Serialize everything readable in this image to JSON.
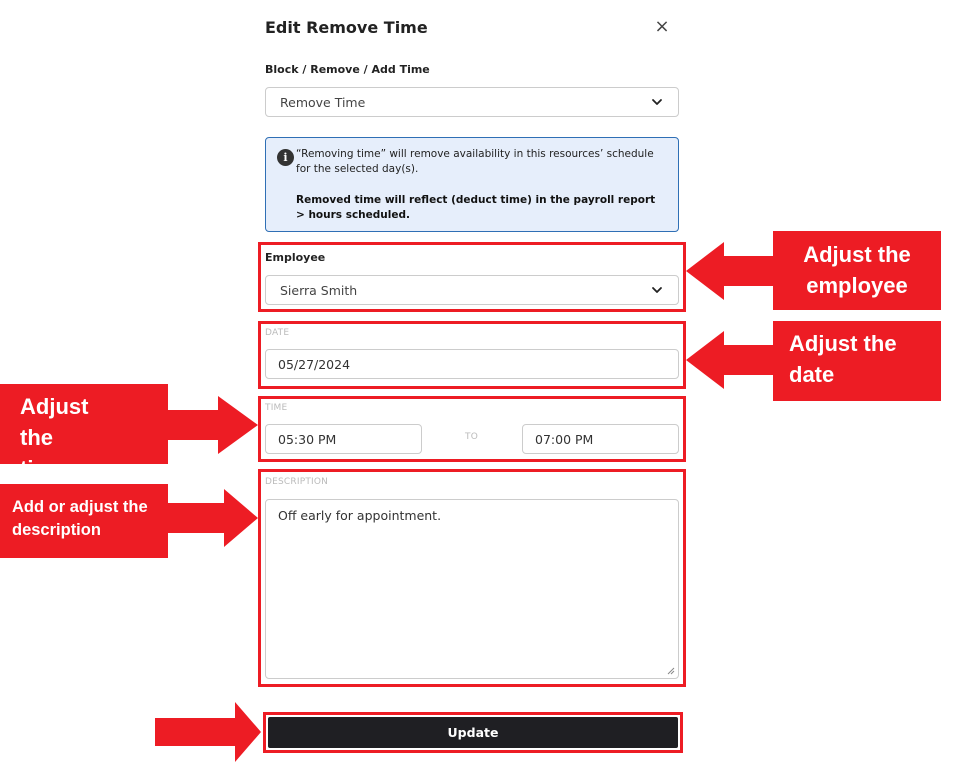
{
  "modal": {
    "title": "Edit Remove Time",
    "close_icon": "×"
  },
  "type_field": {
    "label": "Block / Remove / Add Time",
    "value": "Remove Time"
  },
  "info": {
    "icon": "i",
    "line1": "“Removing time” will remove availability in this resources’ schedule for the selected day(s).",
    "line2": "Removed time will reflect (deduct time) in the payroll report > hours scheduled."
  },
  "employee_field": {
    "label": "Employee",
    "value": "Sierra Smith"
  },
  "date_field": {
    "label": "DATE",
    "value": "05/27/2024"
  },
  "time_field": {
    "label": "TIME",
    "start": "05:30 PM",
    "separator": "TO",
    "end": "07:00 PM"
  },
  "description_field": {
    "label": "DESCRIPTION",
    "value": "Off early for appointment."
  },
  "update_button": "Update",
  "annotations": {
    "employee": "Adjust the employee",
    "date": "Adjust the date",
    "time": "Adjust the time",
    "description": "Add or adjust the description"
  },
  "colors": {
    "annotation_red": "#ed1c24",
    "info_border": "#2f6fb5",
    "info_bg": "#e6eefb",
    "button_bg": "#1f1f23"
  }
}
